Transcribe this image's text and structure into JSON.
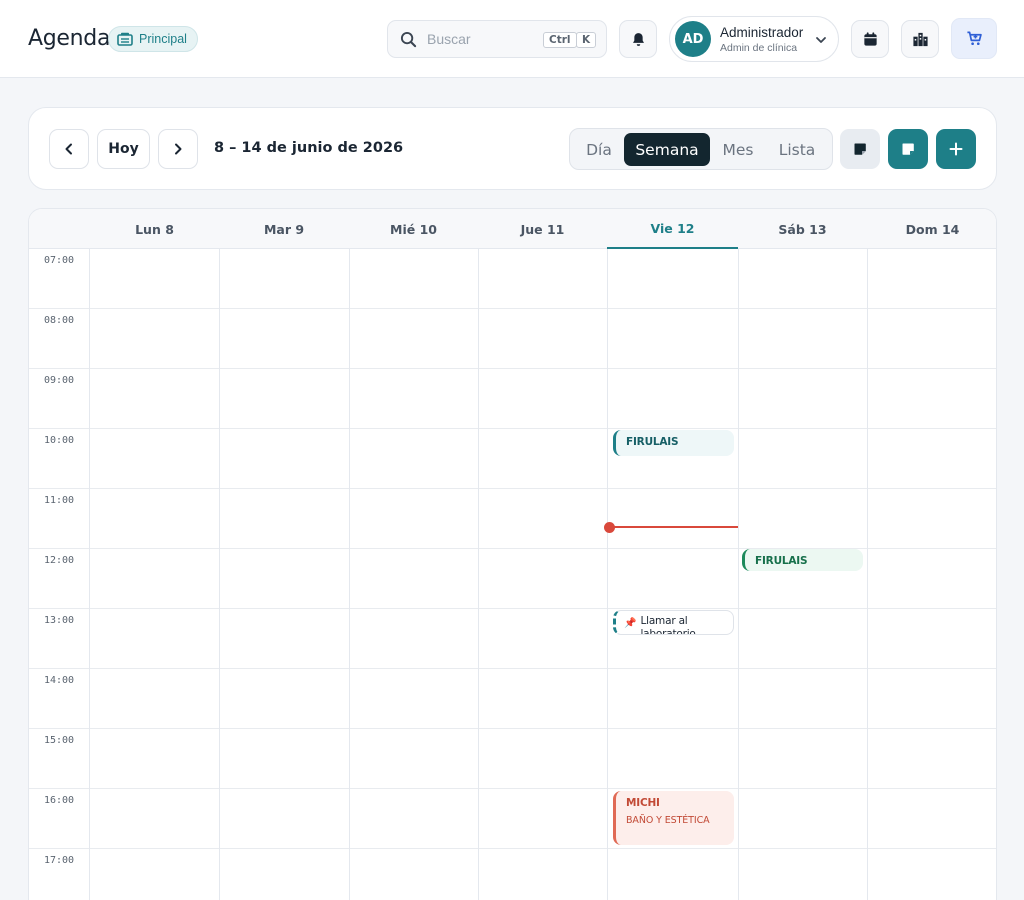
{
  "header": {
    "title": "Agenda",
    "badge": "Principal",
    "search_placeholder": "Buscar",
    "shortcut": [
      "Ctrl",
      "K"
    ],
    "user": {
      "initials": "AD",
      "name": "Administrador",
      "role": "Admin de clínica"
    }
  },
  "toolbar": {
    "today_label": "Hoy",
    "range": "8 – 14 de junio de 2026",
    "views": [
      "Día",
      "Semana",
      "Mes",
      "Lista"
    ],
    "active_view": "Semana"
  },
  "calendar": {
    "days": [
      "Lun 8",
      "Mar 9",
      "Mié 10",
      "Jue 11",
      "Vie 12",
      "Sáb 13",
      "Dom 14"
    ],
    "today": "Vie 12",
    "hours": [
      "07:00",
      "08:00",
      "09:00",
      "10:00",
      "11:00",
      "12:00",
      "13:00",
      "14:00",
      "15:00",
      "16:00",
      "17:00"
    ],
    "events": [
      {
        "title": "FIRULAIS",
        "day": "Vie 12",
        "start": "10:00"
      },
      {
        "title": "FIRULAIS",
        "day": "Sáb 13",
        "start": "12:00"
      },
      {
        "title": "Llamar al laboratorio",
        "day": "Vie 12",
        "start": "13:00",
        "type": "note"
      },
      {
        "title": "MICHI",
        "subtitle": "BAÑO Y ESTÉTICA",
        "day": "Vie 12",
        "start": "16:00"
      }
    ],
    "now": "11:30"
  },
  "colors": {
    "accent": "#1e7f88",
    "dark": "#13262f",
    "now": "#d9483b"
  }
}
